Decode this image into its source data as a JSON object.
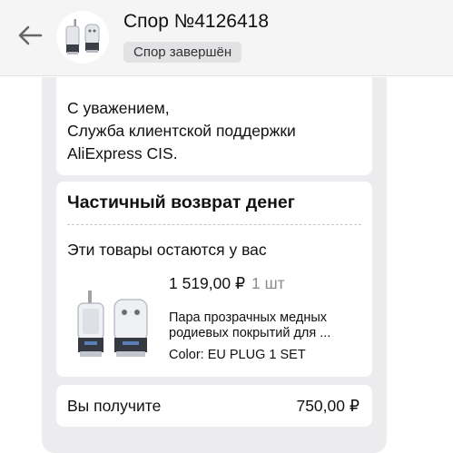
{
  "header": {
    "title": "Спор №4126418",
    "status_badge": "Спор завершён",
    "back_icon": "arrow-left-icon"
  },
  "message": {
    "lines": [
      "С уважением,",
      "Служба клиентской поддержки",
      "AliExpress CIS."
    ]
  },
  "refund": {
    "title": "Частичный возврат денег",
    "subtitle": "Эти товары остаются у вас",
    "product": {
      "price": "1 519,00 ₽",
      "quantity": "1 шт",
      "name": "Пара прозрачных медных родиевых покрытий для ...",
      "attribute": "Color: EU PLUG 1 SET"
    }
  },
  "total": {
    "label": "Вы получите",
    "value": "750,00 ₽"
  },
  "colors": {
    "header_bg": "#f5f5f6",
    "feed_bg": "#ececee",
    "badge_bg": "#e2e2e5",
    "muted": "#8a8a8f"
  }
}
